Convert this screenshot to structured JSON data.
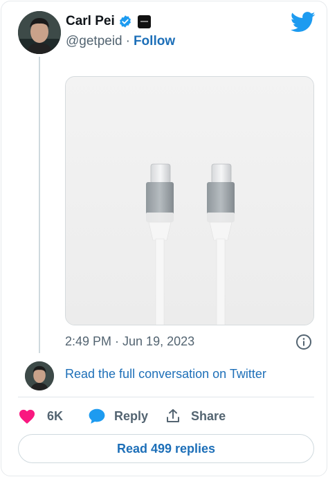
{
  "author": {
    "name": "Carl Pei",
    "handle": "@getpeid",
    "separator": "·",
    "follow_label": "Follow",
    "verified_icon": "verified-badge-icon",
    "affiliation_icon": "nothing-logo-icon"
  },
  "tweet": {
    "timestamp": "2:49 PM · Jun 19, 2023",
    "media_description_icon": "usb-c-cables-image"
  },
  "conversation_link": "Read the full conversation on Twitter",
  "actions": {
    "like_count": "6K",
    "reply_label": "Reply",
    "share_label": "Share"
  },
  "read_replies_label": "Read 499 replies",
  "colors": {
    "accent": "#1d6fb8",
    "twitter_blue": "#1d9bf0",
    "like_pink": "#f91880",
    "muted": "#536471"
  }
}
